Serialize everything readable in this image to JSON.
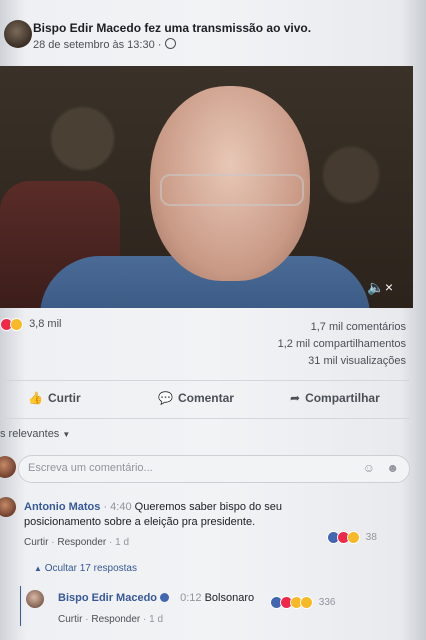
{
  "post": {
    "title": "Bispo Edir Macedo fez uma transmissão ao vivo.",
    "time": "28 de setembro às 13:30 ·"
  },
  "reactions": {
    "total": "3,8 mil",
    "comments": "1,7 mil comentários",
    "shares": "1,2 mil compartilhamentos",
    "views": "31 mil visualizações"
  },
  "actions": {
    "like": "Curtir",
    "comment": "Comentar",
    "share": "Compartilhar"
  },
  "filter": {
    "label": "s relevantes"
  },
  "comment_input": {
    "placeholder": "Escreva um comentário..."
  },
  "comment": {
    "author": "Antonio Matos",
    "time": "· 4:40",
    "text_line1": "Queremos saber bispo do seu",
    "text_line2": "posicionamento sobre a eleição pra presidente.",
    "like": "Curtir",
    "reply": "Responder",
    "age": "· 1 d",
    "reaction_count": "38"
  },
  "replies_toggle": "Ocultar 17 respostas",
  "reply": {
    "author": "Bispo Edir Macedo",
    "time": "0:12",
    "text": "Bolsonaro",
    "reaction_count": "336",
    "like": "Curtir",
    "reply": "Responder",
    "age": "· 1 d"
  },
  "colors": {
    "link": "#385898",
    "like_blue": "#4267b2",
    "love_red": "#f0284a",
    "haha_yellow": "#f7b928"
  }
}
